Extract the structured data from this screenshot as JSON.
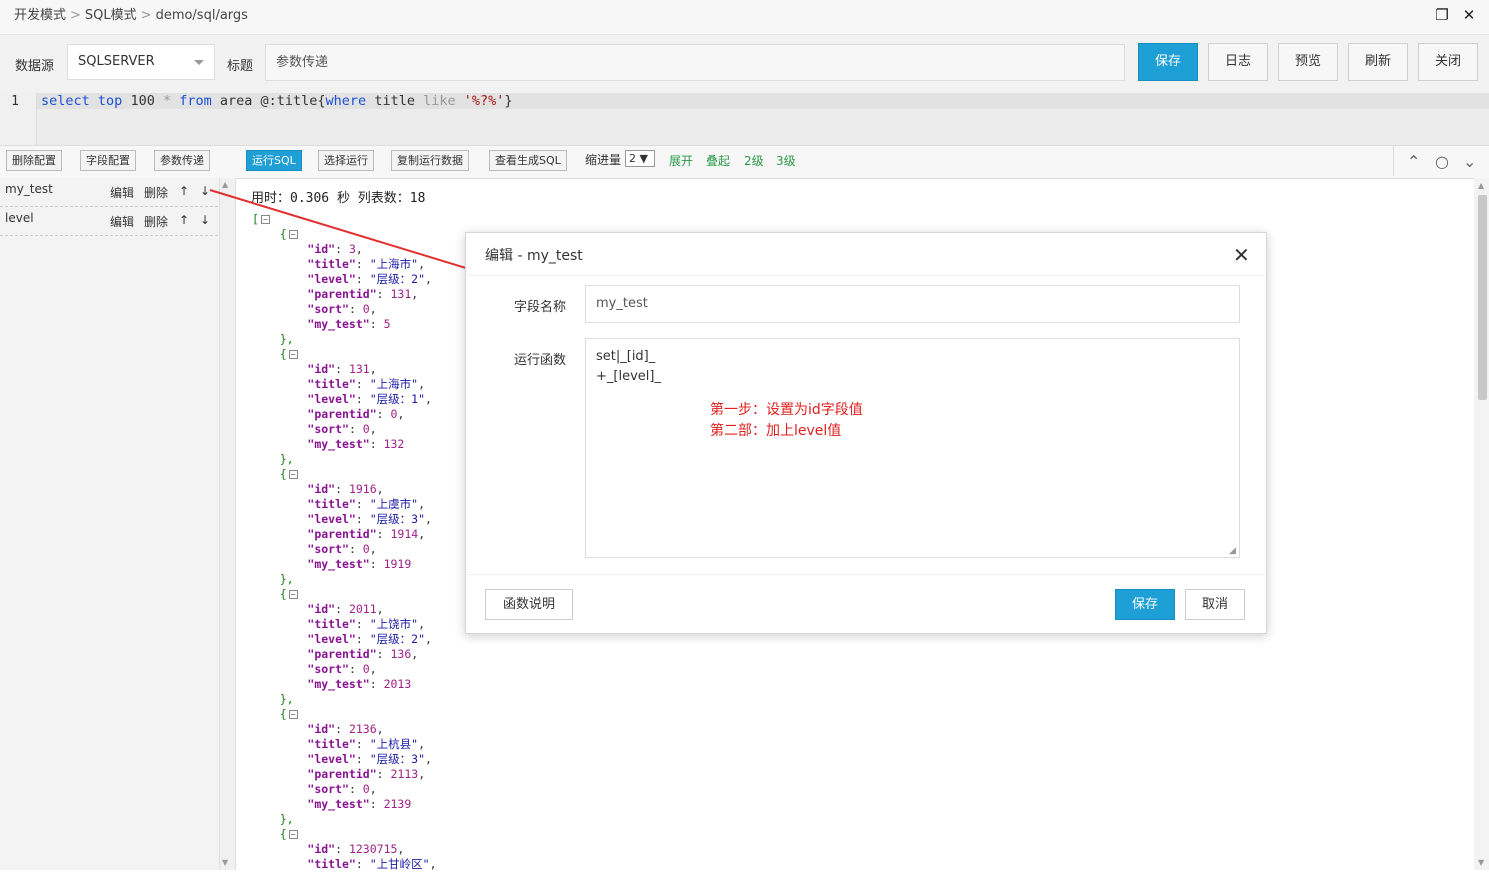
{
  "breadcrumb": [
    "开发模式",
    "SQL模式",
    "demo/sql/args"
  ],
  "window": {
    "restore_icon": "restore-icon",
    "close_icon": "close-icon",
    "restore_glyph": "❐",
    "close_glyph": "✕"
  },
  "toolbar": {
    "datasource_label": "数据源",
    "datasource_value": "SQLSERVER",
    "title_label": "标题",
    "title_value": "参数传递",
    "save": "保存",
    "log": "日志",
    "preview": "预览",
    "refresh": "刷新",
    "close": "关闭"
  },
  "editor": {
    "line_number": "1",
    "tokens": [
      {
        "t": "select",
        "c": "kw"
      },
      {
        "t": " "
      },
      {
        "t": "top",
        "c": "kw"
      },
      {
        "t": " 100 "
      },
      {
        "t": "*",
        "c": "op"
      },
      {
        "t": " "
      },
      {
        "t": "from",
        "c": "kw"
      },
      {
        "t": " area @:title{"
      },
      {
        "t": "where",
        "c": "kw"
      },
      {
        "t": " title "
      },
      {
        "t": "like",
        "c": "op"
      },
      {
        "t": " "
      },
      {
        "t": "'%?%'",
        "c": "str"
      },
      {
        "t": "}"
      }
    ]
  },
  "subbar": {
    "delete_config": "删除配置",
    "field_config": "字段配置",
    "param_pass": "参数传递",
    "run_sql": "运行SQL",
    "select_run": "选择运行",
    "copy_data": "复制运行数据",
    "view_sql": "查看生成SQL",
    "indent_label": "缩进量",
    "indent_value": "2 ▼",
    "expand": "展开",
    "collapse": "叠起",
    "level2": "2级",
    "level3": "3级"
  },
  "fields": [
    {
      "name": "my_test",
      "edit": "编辑",
      "delete": "删除",
      "up": "↑",
      "down": "↓"
    },
    {
      "name": "level",
      "edit": "编辑",
      "delete": "删除",
      "up": "↑",
      "down": "↓"
    }
  ],
  "result": {
    "timing": "用时：0.306 秒  列表数：18",
    "records": [
      {
        "id": "3",
        "title": "\"上海市\"",
        "level": "\"层级：2\"",
        "parentid": "131",
        "sort": "0",
        "my_test": "5"
      },
      {
        "id": "131",
        "title": "\"上海市\"",
        "level": "\"层级：1\"",
        "parentid": "0",
        "sort": "0",
        "my_test": "132"
      },
      {
        "id": "1916",
        "title": "\"上虞市\"",
        "level": "\"层级：3\"",
        "parentid": "1914",
        "sort": "0",
        "my_test": "1919"
      },
      {
        "id": "2011",
        "title": "\"上饶市\"",
        "level": "\"层级：2\"",
        "parentid": "136",
        "sort": "0",
        "my_test": "2013"
      },
      {
        "id": "2136",
        "title": "\"上杭县\"",
        "level": "\"层级：3\"",
        "parentid": "2113",
        "sort": "0",
        "my_test": "2139"
      },
      {
        "id": "1230715",
        "title": "\"上甘岭区\""
      }
    ]
  },
  "modal": {
    "title": "编辑 - my_test",
    "field_name_label": "字段名称",
    "field_name_value": "my_test",
    "func_label": "运行函数",
    "func_line1": "set|_[id]_",
    "func_line2": "+_[level]_",
    "annotation": "第一步：设置为id字段值\n第二部：加上level值",
    "func_help": "函数说明",
    "save": "保存",
    "cancel": "取消"
  },
  "colors": {
    "primary": "#1e9fd6",
    "green": "#2a9a4a",
    "annotation": "#e02020"
  }
}
